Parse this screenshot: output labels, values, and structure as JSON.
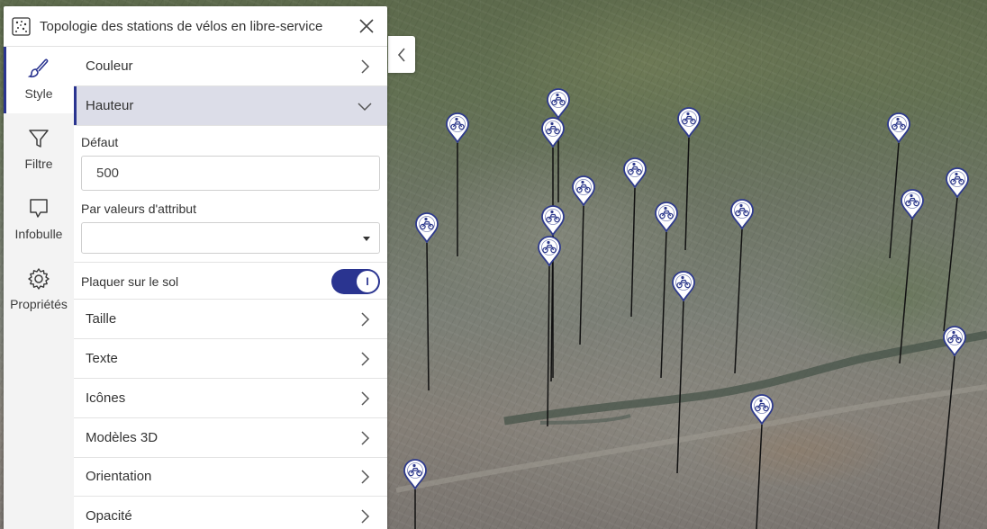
{
  "panel": {
    "title": "Topologie des stations de vélos en libre-service",
    "layer_icon": "point-cloud-icon",
    "close_icon": "close-icon"
  },
  "sidebar": {
    "tabs": [
      {
        "label": "Style",
        "icon": "paintbrush-icon",
        "active": true
      },
      {
        "label": "Filtre",
        "icon": "funnel-icon",
        "active": false
      },
      {
        "label": "Infobulle",
        "icon": "speech-bubble-icon",
        "active": false
      },
      {
        "label": "Propriétés",
        "icon": "gear-icon",
        "active": false
      }
    ]
  },
  "sections": {
    "couleur": "Couleur",
    "hauteur": "Hauteur",
    "taille": "Taille",
    "texte": "Texte",
    "icones": "Icônes",
    "modeles3d": "Modèles 3D",
    "orientation": "Orientation",
    "opacite": "Opacité"
  },
  "hauteur": {
    "default_label": "Défaut",
    "default_value": "500",
    "attr_label": "Par valeurs d'attribut",
    "attr_value": "",
    "clamp_label": "Plaquer sur le sol",
    "clamp_on": true,
    "clamp_knob_text": "I"
  },
  "colors": {
    "accent": "#2a3490",
    "marker": "#2e3a8c"
  },
  "map": {
    "marker_icon": "bicycle-station-icon",
    "collapse_icon": "chevron-left-icon"
  }
}
